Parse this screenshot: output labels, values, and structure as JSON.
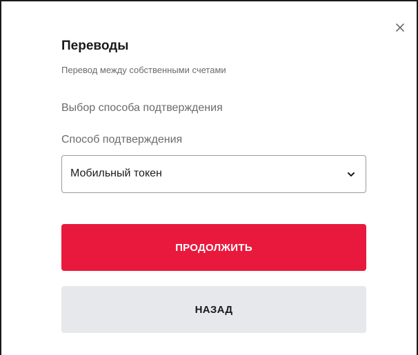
{
  "dialog": {
    "title": "Переводы",
    "subtitle": "Перевод между собственными счетами",
    "step_label": "Выбор способа подтверждения",
    "close_icon": "close-icon"
  },
  "form": {
    "confirmation_method": {
      "label": "Способ подтверждения",
      "selected_value": "Мобильный токен",
      "icon": "chevron-down-icon"
    }
  },
  "actions": {
    "continue_label": "ПРОДОЛЖИТЬ",
    "back_label": "НАЗАД"
  },
  "colors": {
    "primary": "#e8193c",
    "secondary": "#e6e8ec",
    "text": "#1a1a1a",
    "muted_text": "#6b6b6b"
  }
}
